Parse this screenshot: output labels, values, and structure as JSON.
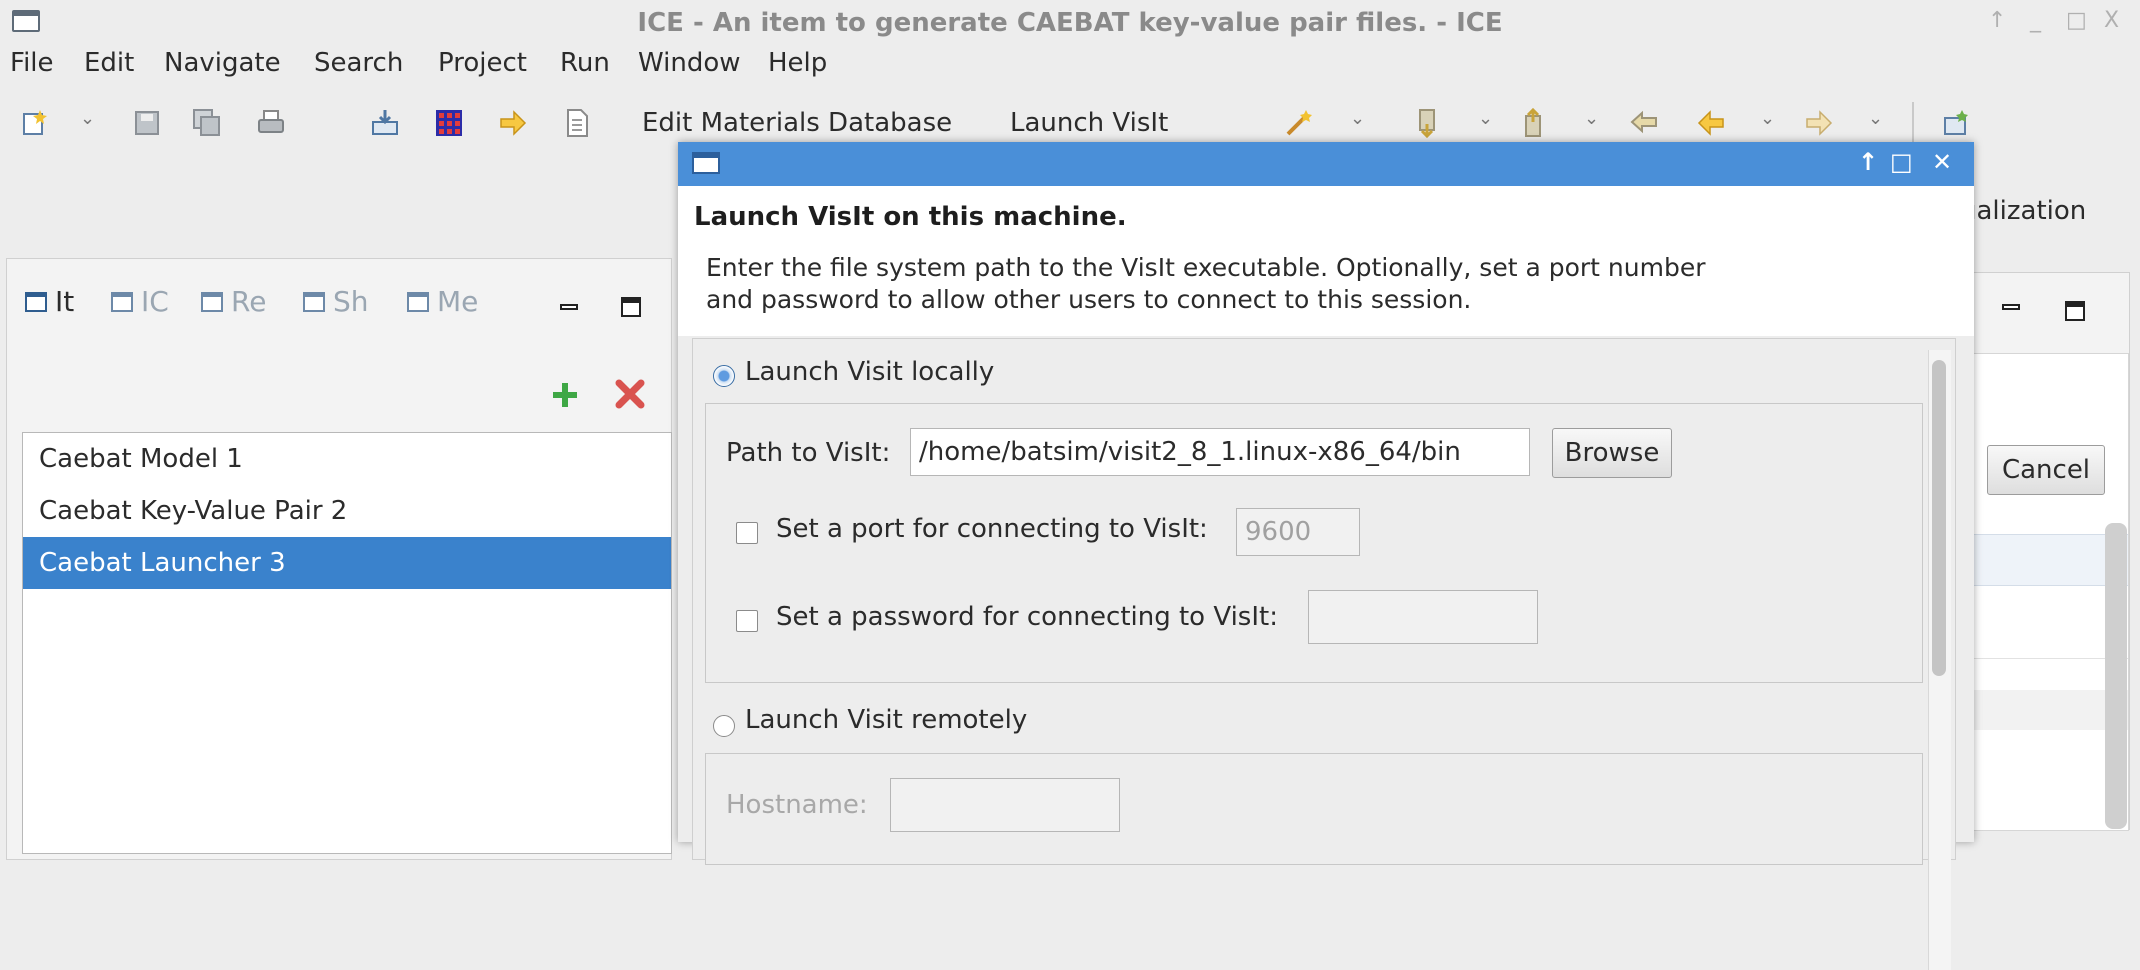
{
  "window": {
    "title": "ICE - An item to generate CAEBAT key-value pair files. - ICE",
    "controls": [
      "↑",
      "_",
      "□",
      "X"
    ]
  },
  "menubar": [
    "File",
    "Edit",
    "Navigate",
    "Search",
    "Project",
    "Run",
    "Window",
    "Help"
  ],
  "toolbar": {
    "edit_materials": "Edit Materials Database",
    "launch_visit": "Launch VisIt"
  },
  "perspective_label": "ualization",
  "left_view": {
    "tabs": [
      "It",
      "IC",
      "Re",
      "Sh",
      "Me"
    ],
    "items": [
      "Caebat Model 1",
      "Caebat Key-Value Pair 2",
      "Caebat Launcher 3"
    ],
    "selected_index": 2
  },
  "background_cancel": "Cancel",
  "dialog": {
    "title_controls": [
      "↑",
      "□",
      "✕"
    ],
    "heading": "Launch VisIt on this machine.",
    "description_line1": "Enter the file system path to the VisIt executable. Optionally, set a port number",
    "description_line2": "and password to allow other users to connect to this session.",
    "local_option": "Launch Visit locally",
    "path_label": "Path to VisIt:",
    "path_value": "/home/batsim/visit2_8_1.linux-x86_64/bin",
    "browse": "Browse",
    "port_label": "Set a port for connecting to VisIt:",
    "port_value": "9600",
    "password_label": "Set a password for connecting to VisIt:",
    "remote_option": "Launch Visit remotely",
    "hostname_label": "Hostname:"
  },
  "colors": {
    "dialog_title": "#4a8fd8",
    "selection": "#3a82cc"
  }
}
